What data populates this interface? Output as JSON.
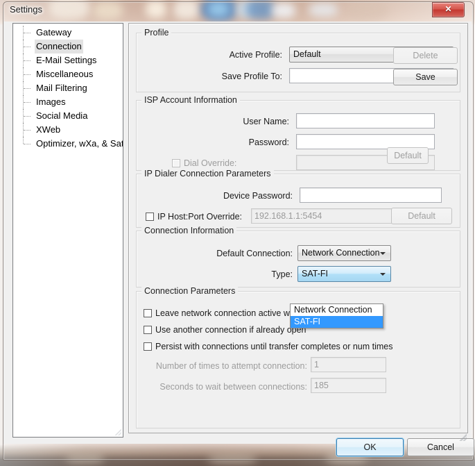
{
  "window": {
    "title": "Settings",
    "close_label": "✕"
  },
  "sidebar": {
    "items": [
      {
        "label": "Gateway",
        "selected": false
      },
      {
        "label": "Connection",
        "selected": true
      },
      {
        "label": "E-Mail Settings",
        "selected": false
      },
      {
        "label": "Miscellaneous",
        "selected": false
      },
      {
        "label": "Mail Filtering",
        "selected": false
      },
      {
        "label": "Images",
        "selected": false
      },
      {
        "label": "Social Media",
        "selected": false
      },
      {
        "label": "XWeb",
        "selected": false
      },
      {
        "label": "Optimizer, wXa, & Sat-Fi",
        "selected": false
      }
    ]
  },
  "profile": {
    "group_label": "Profile",
    "active_profile_label": "Active Profile:",
    "active_profile_value": "Default",
    "delete_button": "Delete",
    "save_profile_to_label": "Save Profile To:",
    "save_profile_to_value": "",
    "save_button": "Save"
  },
  "isp": {
    "group_label": "ISP Account Information",
    "user_name_label": "User Name:",
    "user_name_value": "",
    "password_label": "Password:",
    "password_value": "",
    "dial_override_label": "Dial Override:",
    "dial_override_value": "",
    "dial_override_default_button": "Default"
  },
  "ip_dialer": {
    "group_label": "IP Dialer Connection Parameters",
    "device_password_label": "Device Password:",
    "device_password_value": "",
    "ip_host_port_label": "IP Host:Port Override:",
    "ip_host_port_value": "192.168.1.1:5454",
    "ip_host_port_default_button": "Default"
  },
  "connection_info": {
    "group_label": "Connection Information",
    "default_connection_label": "Default Connection:",
    "default_connection_value": "Network Connection",
    "type_label": "Type:",
    "type_value": "SAT-FI",
    "type_options": [
      {
        "label": "Network Connection",
        "selected": false
      },
      {
        "label": "SAT-FI",
        "selected": true
      }
    ]
  },
  "connection_params": {
    "group_label": "Connection Parameters",
    "leave_active_label": "Leave network connection active when done",
    "use_another_label": "Use another connection if already open",
    "persist_label": "Persist with connections until transfer completes or num times",
    "num_times_label": "Number of times to attempt connection:",
    "num_times_value": "1",
    "seconds_wait_label": "Seconds to wait between connections:",
    "seconds_wait_value": "185"
  },
  "footer": {
    "ok_button": "OK",
    "cancel_button": "Cancel"
  }
}
